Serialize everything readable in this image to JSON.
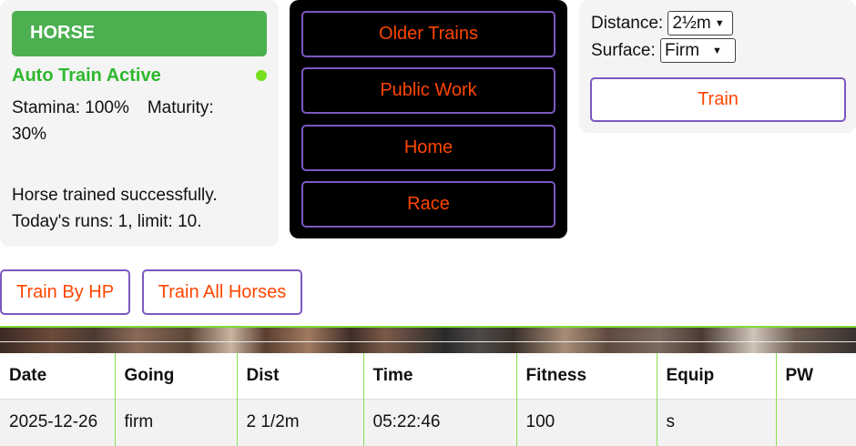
{
  "status": {
    "horse_label": "HORSE",
    "auto_train": "Auto Train Active",
    "stamina": "Stamina: 100%",
    "maturity_line1": "Maturity:",
    "maturity_line2": "30%",
    "message_line1": "Horse trained successfully.",
    "message_line2": "Today's runs: 1, limit: 10.",
    "indicator_color": "#76e01e"
  },
  "nav": {
    "items": [
      {
        "label": "Older Trains"
      },
      {
        "label": "Public Work"
      },
      {
        "label": "Home"
      },
      {
        "label": "Race"
      }
    ]
  },
  "train_form": {
    "distance_label": "Distance:",
    "distance_value": "2½m",
    "surface_label": "Surface:",
    "surface_value": "Firm",
    "train_button": "Train"
  },
  "actions": {
    "train_by_hp": "Train By HP",
    "train_all": "Train All Horses"
  },
  "table": {
    "headers": [
      "Date",
      "Going",
      "Dist",
      "Time",
      "Fitness",
      "Equip",
      "PW"
    ],
    "rows": [
      [
        "2025-12-26",
        "firm",
        "2 1/2m",
        "05:22:46",
        "100",
        "s",
        ""
      ]
    ]
  },
  "colors": {
    "accent_green": "#4caf50",
    "button_border": "#7e57c2",
    "button_text": "#ff4500"
  }
}
